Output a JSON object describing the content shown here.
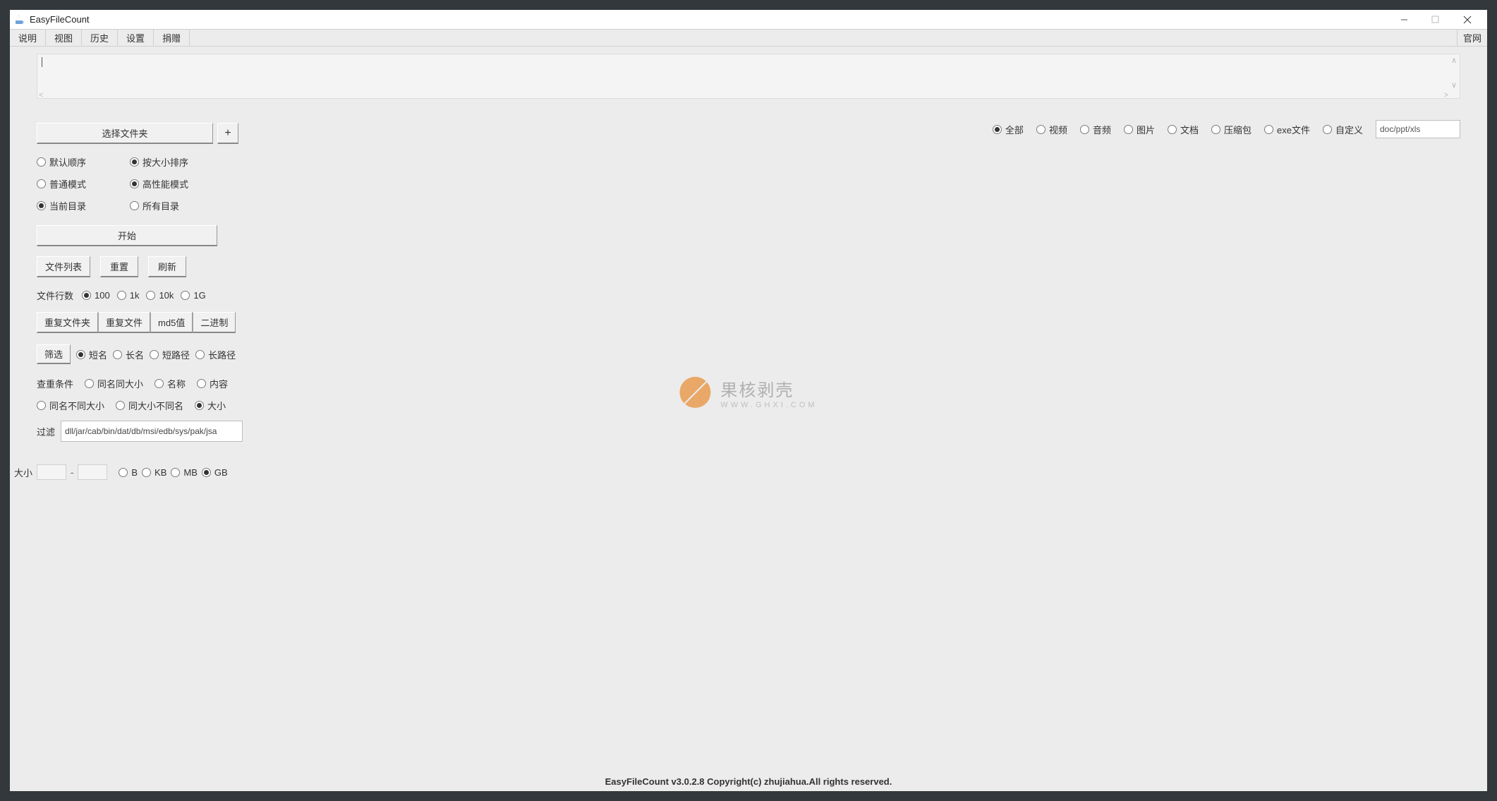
{
  "window": {
    "title": "EasyFileCount"
  },
  "menu": {
    "items": [
      "说明",
      "视图",
      "历史",
      "设置",
      "捐赠"
    ],
    "official": "官网"
  },
  "typeFilter": {
    "options": [
      "全部",
      "视频",
      "音频",
      "图片",
      "文档",
      "压缩包",
      "exe文件",
      "自定义"
    ],
    "selected": "全部",
    "custom_value": "doc/ppt/xls"
  },
  "selectFolder": {
    "button": "选择文件夹",
    "plus": "+"
  },
  "order": {
    "default": "默认顺序",
    "bySize": "按大小排序",
    "selected": "bySize"
  },
  "mode": {
    "normal": "普通模式",
    "highPerf": "高性能模式",
    "selected": "highPerf"
  },
  "scope": {
    "current": "当前目录",
    "all": "所有目录",
    "selected": "current"
  },
  "start": "开始",
  "actions": {
    "fileList": "文件列表",
    "reset": "重置",
    "refresh": "刷新"
  },
  "lineCount": {
    "label": "文件行数",
    "options": [
      "100",
      "1k",
      "10k",
      "1G"
    ],
    "selected": "100"
  },
  "dupTools": [
    "重复文件夹",
    "重复文件",
    "md5值",
    "二进制"
  ],
  "filterToggle": {
    "button": "筛选",
    "options": [
      "短名",
      "长名",
      "短路径",
      "长路径"
    ],
    "selected": "短名"
  },
  "dupCond": {
    "label": "查重条件",
    "row1": [
      "同名同大小",
      "名称",
      "内容"
    ],
    "row2": [
      "同名不同大小",
      "同大小不同名",
      "大小"
    ],
    "selected": "大小"
  },
  "filterExt": {
    "label": "过滤",
    "value": "dll/jar/cab/bin/dat/db/msi/edb/sys/pak/jsa"
  },
  "sizeFilter": {
    "label": "大小",
    "from": "",
    "to": "",
    "dash": "-",
    "units": [
      "B",
      "KB",
      "MB",
      "GB"
    ],
    "selected": "GB"
  },
  "watermark": {
    "cn": "果核剥壳",
    "en": "WWW.GHXI.COM"
  },
  "footer": "EasyFileCount v3.0.2.8 Copyright(c) zhujiahua.All rights reserved."
}
